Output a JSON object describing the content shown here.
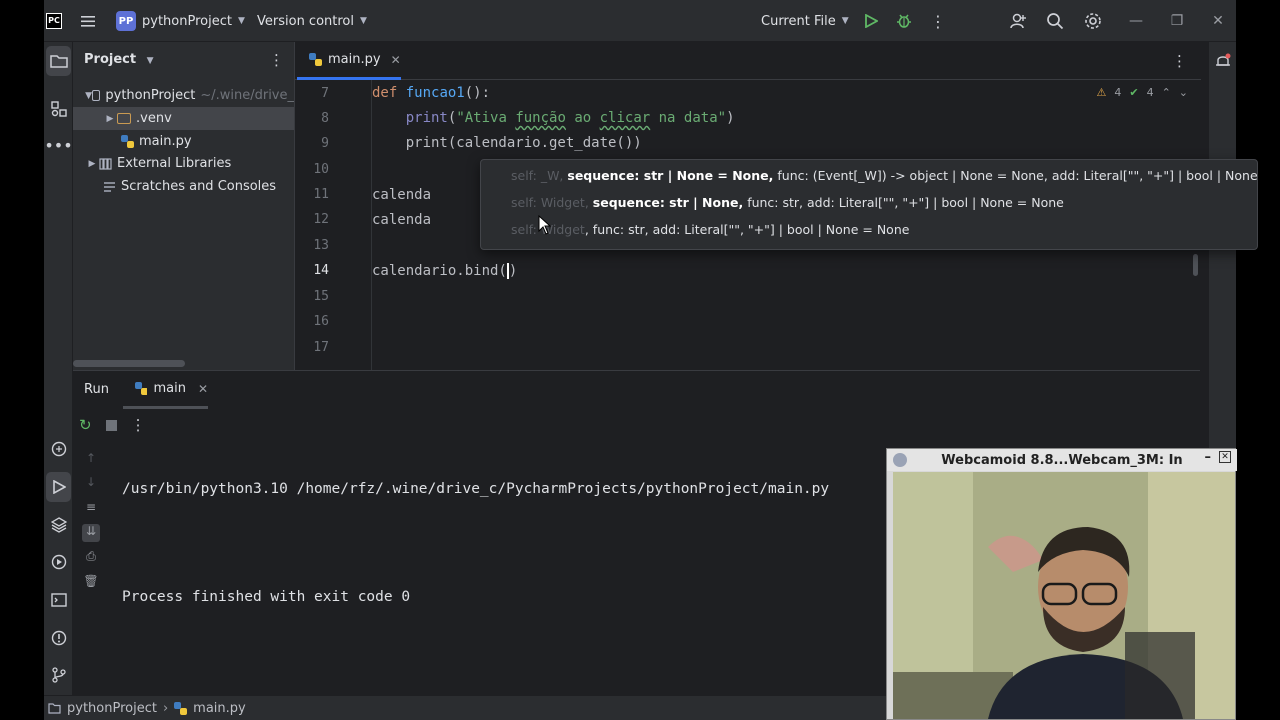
{
  "titlebar": {
    "logo": "PC",
    "project_badge": "PP",
    "project_name": "pythonProject",
    "vcs": "Version control",
    "run_config": "Current File"
  },
  "project_panel": {
    "header": "Project",
    "tree": [
      {
        "label": "pythonProject",
        "hint": "~/.wine/drive_"
      },
      {
        "label": ".venv"
      },
      {
        "label": "main.py"
      },
      {
        "label": "External Libraries"
      },
      {
        "label": "Scratches and Consoles"
      }
    ]
  },
  "editor": {
    "tab": "main.py",
    "inspections": {
      "warnings": "4",
      "ok": "4"
    },
    "line_numbers": [
      "7",
      "8",
      "9",
      "10",
      "11",
      "12",
      "13",
      "14",
      "15",
      "16",
      "17"
    ],
    "code": {
      "l7_kw": "def",
      "l7_fn": "funcao1",
      "l7_rest": "():",
      "l8_print": "print",
      "l8_open": "(",
      "l8_str_a": "\"Ativa ",
      "l8_str_b": "função",
      "l8_str_c": " ao ",
      "l8_str_d": "clicar",
      "l8_str_e": " na data\"",
      "l8_close": ")",
      "l9": "print(calendario.get_date())",
      "l11": "calenda",
      "l12": "calenda",
      "l14": "calendario.bind(",
      "l14_close": ")"
    },
    "popup": {
      "line1_faint": "self: _W,",
      "line1_bold": "sequence: str | None = None,",
      "line1_rest": "func: (Event[_W]) -> object | None = None, add: Literal[\"\", \"+\"] | bool | None = None",
      "line2_faint": "self: Widget,",
      "line2_bold": "sequence: str | None,",
      "line2_rest": "func: str, add: Literal[\"\", \"+\"] | bool | None = None",
      "line3_faint": "self: Widget",
      "line3_rest": ", func: str, add: Literal[\"\", \"+\"] | bool | None = None"
    }
  },
  "run_panel": {
    "title": "Run",
    "tab": "main",
    "console": [
      "/usr/bin/python3.10 /home/rfz/.wine/drive_c/PycharmProjects/pythonProject/main.py",
      "",
      "Process finished with exit code 0"
    ]
  },
  "statusbar": {
    "project": "pythonProject",
    "file": "main.py"
  },
  "webcam": {
    "title": "Webcamoid 8.8...Webcam_3M: In"
  }
}
